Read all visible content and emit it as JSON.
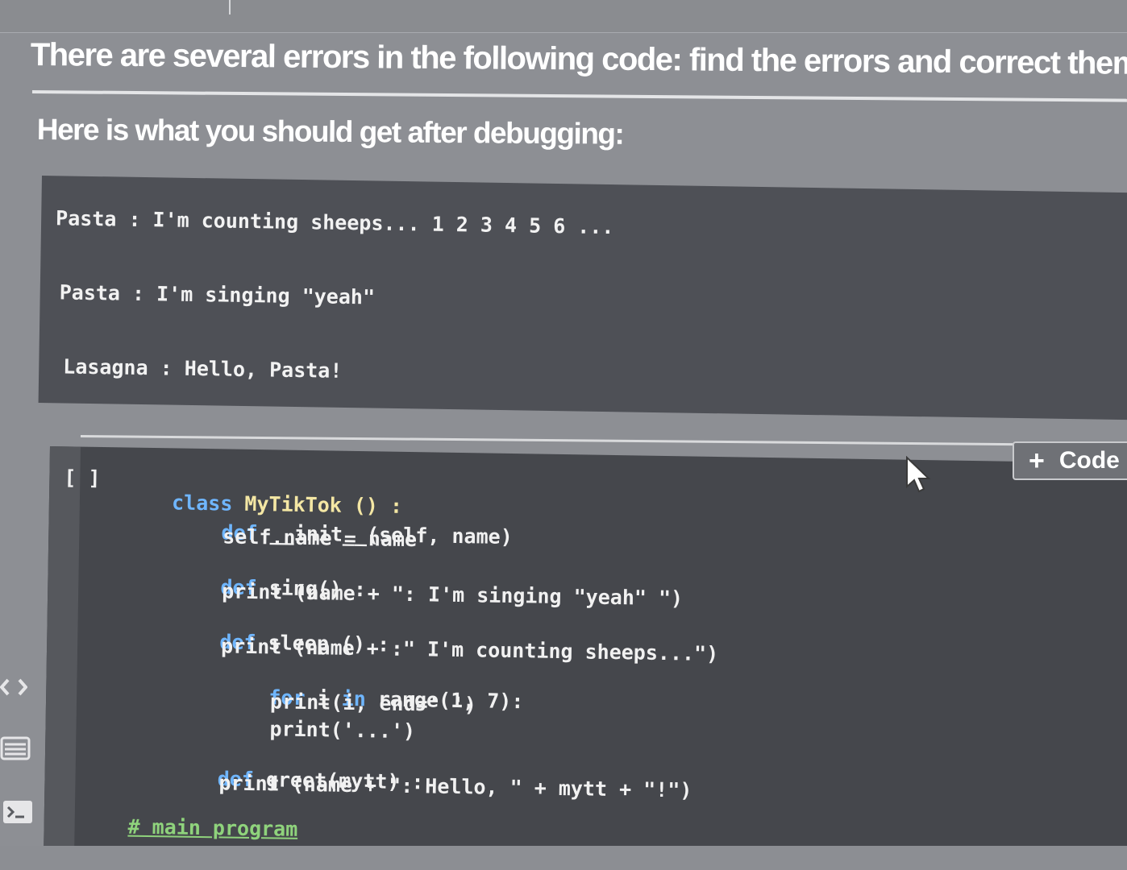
{
  "instructions": {
    "title": "There are several errors in the following code: find the errors and correct them.",
    "subtitle": "Here is what you should get after debugging:"
  },
  "expected_output": {
    "lines": [
      "Pasta : I'm counting sheeps... 1 2 3 4 5 6 ...",
      "Pasta : I'm singing \"yeah\"",
      "Lasagna : Hello, Pasta!"
    ]
  },
  "code_cell": {
    "run_indicator": "[ ]",
    "add_code_button": {
      "plus": "+",
      "label": "Code"
    },
    "lines": {
      "l1_kw": "class",
      "l1_rest": " MyTikTok () :",
      "l2_kw": "def",
      "l2_rest": " __init__(self, name)",
      "l3": "self.name = name",
      "l4_kw": "def",
      "l4_rest": " sing() :",
      "l5": "print (name + \": I'm singing \"yeah\" \")",
      "l6_kw": "def",
      "l6_rest": " sleep () :",
      "l7": "print (name + :\" I'm counting sheeps...\")",
      "l8_kw1": "for",
      "l8_mid": " i ",
      "l8_kw2": "in",
      "l8_rest": " range(1, 7):",
      "l9": "print(i, end=' ')",
      "l10": "print('...')",
      "l11_kw": "def",
      "l11_rest": " greet(mytt) :",
      "l12": "print (name + \": Hello, \" + mytt + \"!\")",
      "l13": "# main program"
    }
  },
  "left_rail": {
    "icons": [
      "code-brackets-icon",
      "list-icon",
      "terminal-icon"
    ]
  },
  "colors": {
    "background": "#8d8f94",
    "output_box": "#4e5056",
    "code_cell": "#45474c",
    "keyword": "#6fb6ff",
    "comment": "#8fd37c"
  }
}
